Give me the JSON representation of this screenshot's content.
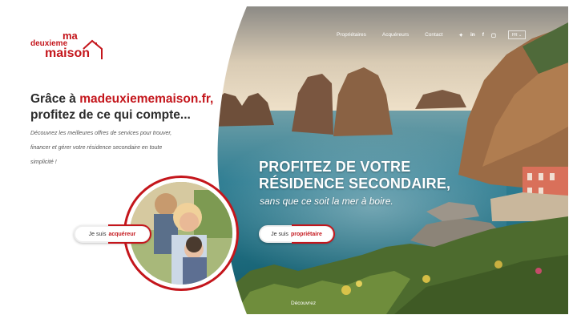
{
  "logo": {
    "line1": "ma",
    "line2": "deuxieme",
    "line3": "maison"
  },
  "nav": {
    "links": [
      "Propriétaires",
      "Acquéreurs",
      "Contact"
    ],
    "social": [
      "twitter-icon",
      "linkedin-icon",
      "facebook-icon",
      "instagram-icon"
    ],
    "social_glyphs": [
      "✦",
      "in",
      "f",
      "▢"
    ],
    "lang": "FR ⌄"
  },
  "headline": {
    "prefix": "Grâce à ",
    "brand": "madeuxiememaison.fr,",
    "rest": "profitez de ce qui compte..."
  },
  "intro": "Découvrez les meilleures offres de services pour trouver, financer et gérer votre résidence secondaire en toute simplicité !",
  "buttons": {
    "acquereur_prefix": "Je suis",
    "acquereur": "acquéreur",
    "proprietaire_prefix": "Je suis",
    "proprietaire": "propriétaire"
  },
  "hero": {
    "title_line1": "PROFITEZ DE VOTRE",
    "title_line2": "RÉSIDENCE SECONDAIRE,",
    "subtitle": "sans que ce soit la mer à boire.",
    "discover": "Découvrez"
  },
  "colors": {
    "brand_red": "#c4161c",
    "sea": "#1f7f93",
    "sky": "#e8dccb"
  }
}
